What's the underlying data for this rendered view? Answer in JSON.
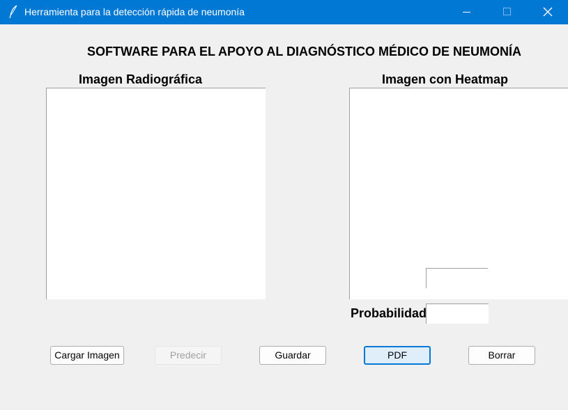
{
  "window": {
    "title": "Herramienta para la detección rápida de neumonía",
    "icons": [
      "feather-icon",
      "minimize-icon",
      "maximize-icon",
      "close-icon"
    ]
  },
  "header": {
    "main_title": "SOFTWARE PARA EL APOYO AL DIAGNÓSTICO MÉDICO DE NEUMONÍA"
  },
  "panels": {
    "xray_label": "Imagen Radiográfica",
    "heatmap_label": "Imagen con Heatmap"
  },
  "results": {
    "probability_label": "Probabilidad:",
    "probability_value": "",
    "result_value": ""
  },
  "buttons": {
    "load": "Cargar Imagen",
    "predict": "Predecir",
    "save": "Guardar",
    "pdf": "PDF",
    "clear": "Borrar"
  },
  "colors": {
    "titlebar": "#0078d4",
    "background": "#f0f0f0",
    "focus": "#0078d4"
  }
}
